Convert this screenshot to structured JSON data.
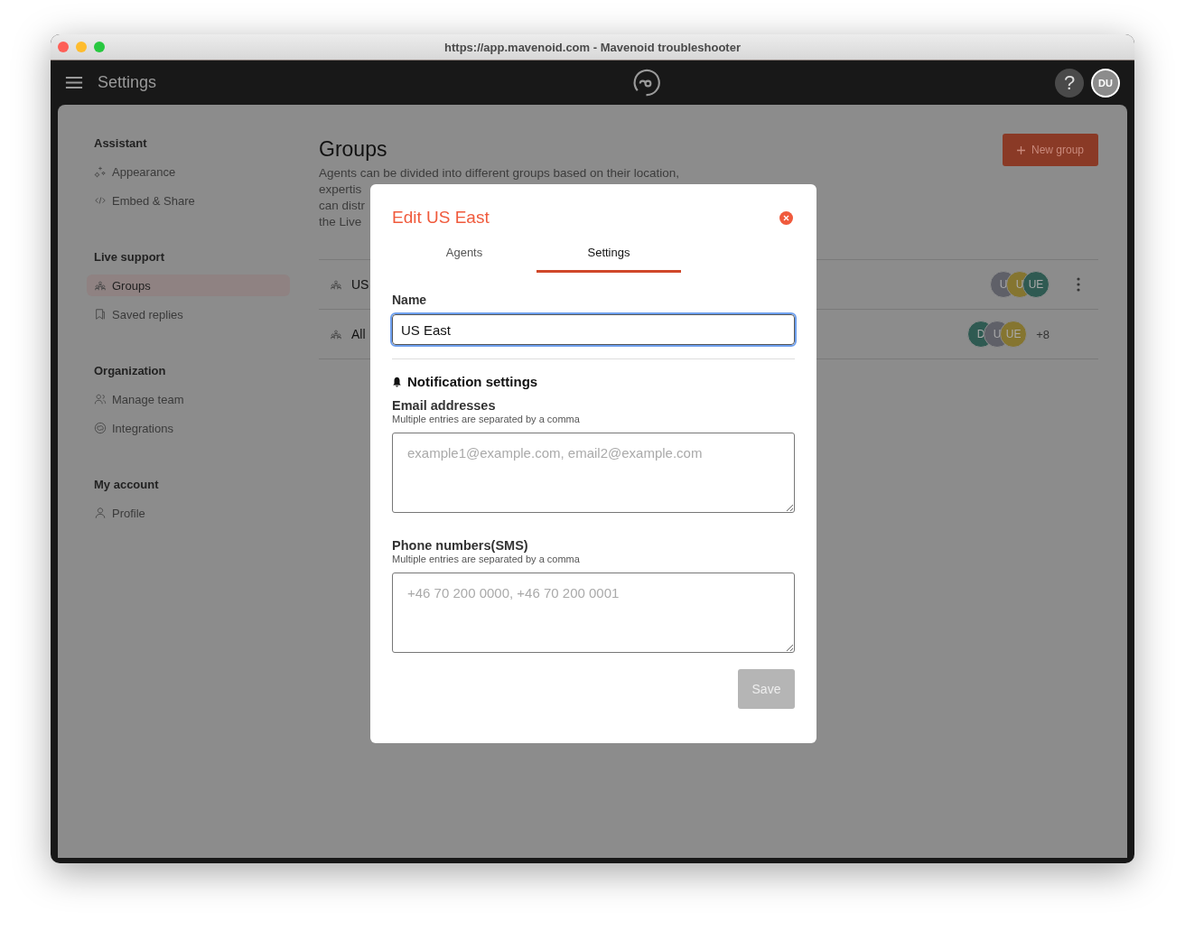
{
  "window": {
    "title": "https://app.mavenoid.com - Mavenoid troubleshooter"
  },
  "app_bar": {
    "title": "Settings",
    "help": "?",
    "avatar": "DU"
  },
  "sidebar": {
    "sections": [
      {
        "heading": "Assistant",
        "items": [
          {
            "label": "Appearance",
            "selected": false
          },
          {
            "label": "Embed & Share",
            "selected": false
          }
        ]
      },
      {
        "heading": "Live support",
        "items": [
          {
            "label": "Groups",
            "selected": true
          },
          {
            "label": "Saved replies",
            "selected": false
          }
        ]
      },
      {
        "heading": "Organization",
        "items": [
          {
            "label": "Manage team",
            "selected": false
          },
          {
            "label": "Integrations",
            "selected": false
          }
        ]
      },
      {
        "heading": "My account",
        "items": [
          {
            "label": "Profile",
            "selected": false
          }
        ]
      }
    ]
  },
  "page": {
    "title": "Groups",
    "new_button": "New group",
    "description_lines": [
      "Agents can be divided into different groups based on their location,",
      "expertis",
      "can distr",
      "the Live"
    ],
    "groups": [
      {
        "name": "US",
        "avatars": [
          {
            "initials": "U",
            "color": "#5f6068"
          },
          {
            "initials": "U",
            "color": "#857530"
          },
          {
            "initials": "UE",
            "color": "#2f5a52"
          }
        ],
        "menu": true
      },
      {
        "name": "All",
        "avatars": [
          {
            "initials": "D",
            "color": "#2f5a52"
          },
          {
            "initials": "U",
            "color": "#5f6068"
          },
          {
            "initials": "UE",
            "color": "#857530"
          }
        ],
        "more": "+8",
        "menu": false
      }
    ]
  },
  "dialog": {
    "title": "Edit US East",
    "tabs": [
      {
        "label": "Agents",
        "selected": false
      },
      {
        "label": "Settings",
        "selected": true
      }
    ],
    "name_label": "Name",
    "name_value": "US East",
    "notification_heading": "Notification settings",
    "email": {
      "label": "Email addresses",
      "hint": "Multiple entries are separated by a comma",
      "placeholder": "example1@example.com, email2@example.com"
    },
    "phone": {
      "label": "Phone numbers(SMS)",
      "hint": "Multiple entries are separated by a comma",
      "placeholder": "+46 70 200 0000, +46 70 200 0001"
    },
    "save": {
      "label": "Save",
      "disabled": true
    }
  }
}
